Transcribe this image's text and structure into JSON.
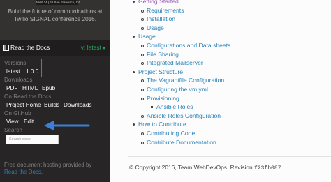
{
  "banner": {
    "image_text": "MAY 24 | 25 San Francisco, CA",
    "text": "Build the future of communications at Twilio SIGNAL conference 2016."
  },
  "rtd": {
    "label": "Read the Docs",
    "current_version": "v: latest",
    "sections": {
      "versions": {
        "label": "Versions",
        "items": [
          "latest",
          "1.0.0"
        ]
      },
      "downloads": {
        "label": "Downloads",
        "items": [
          "PDF",
          "HTML",
          "Epub"
        ]
      },
      "on_rtd": {
        "label": "On Read the Docs",
        "items": [
          "Project Home",
          "Builds",
          "Downloads"
        ]
      },
      "on_github": {
        "label": "On GitHub",
        "items": [
          "View",
          "Edit"
        ]
      },
      "search": {
        "label": "Search",
        "placeholder": "Search docs"
      }
    },
    "footer": {
      "text": "Free document hosting provided by ",
      "link": "Read the Docs",
      "end": "."
    }
  },
  "toc": [
    {
      "label": "Getting Started",
      "level": 1,
      "visited": true
    },
    {
      "label": "Requirements",
      "level": 2
    },
    {
      "label": "Installation",
      "level": 2
    },
    {
      "label": "Usage",
      "level": 2
    },
    {
      "label": "Usage",
      "level": 1
    },
    {
      "label": "Configurations and Data sheets",
      "level": 2
    },
    {
      "label": "File Sharing",
      "level": 2
    },
    {
      "label": "Integrated Mailserver",
      "level": 2
    },
    {
      "label": "Project Structure",
      "level": 1
    },
    {
      "label": "The Vagrantfile Configuration",
      "level": 2
    },
    {
      "label": "Configuring the vm.yml",
      "level": 2
    },
    {
      "label": "Provisioning",
      "level": 2
    },
    {
      "label": "Ansible Roles",
      "level": 3
    },
    {
      "label": "Ansible Roles Configuration",
      "level": 2
    },
    {
      "label": "How to Contribute",
      "level": 1
    },
    {
      "label": "Contributing Code",
      "level": 2
    },
    {
      "label": "Contribute Documentation",
      "level": 2
    }
  ],
  "footer": {
    "copyright": "© Copyright 2016, Team WebDevOps. Revision ",
    "commit": "f23fb087",
    "end": "."
  },
  "colors": {
    "link": "#2980b9",
    "version_green": "#27ae60",
    "highlight": "#3d7fd6"
  }
}
